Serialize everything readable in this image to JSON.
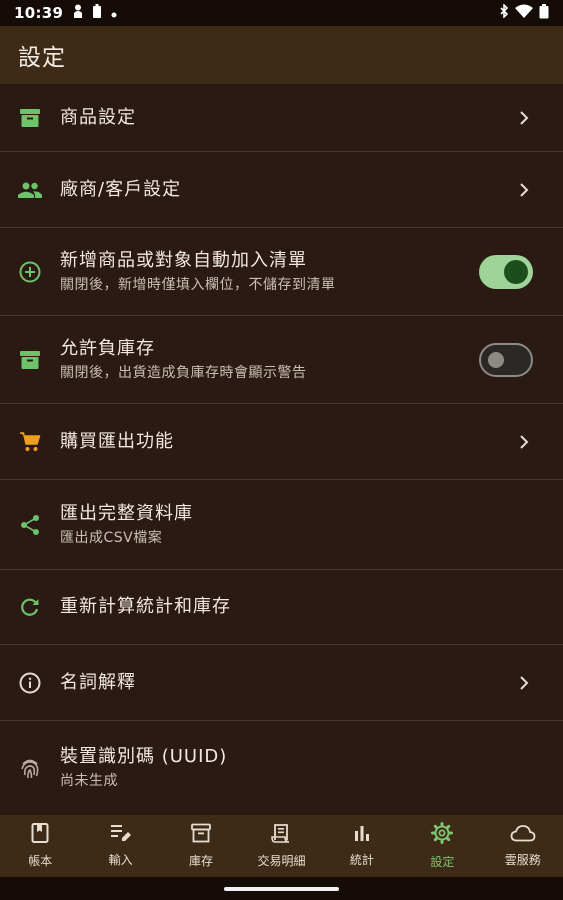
{
  "status_bar": {
    "time": "10:39",
    "left_icons": [
      "person-icon",
      "battery-saver-icon",
      "dot-icon"
    ],
    "right_icons": [
      "bluetooth-icon",
      "wifi-icon",
      "battery-icon"
    ]
  },
  "app_bar": {
    "title": "設定"
  },
  "settings": [
    {
      "id": "products",
      "title": "商品設定",
      "icon": "archive-icon",
      "icon_color": "#6cc36a",
      "control": "chevron"
    },
    {
      "id": "vendors",
      "title": "廠商/客戶設定",
      "icon": "people-icon",
      "icon_color": "#6cc36a",
      "control": "chevron"
    },
    {
      "id": "auto-add",
      "title": "新增商品或對象自動加入清單",
      "subtitle": "關閉後，新增時僅填入欄位，不儲存到清單",
      "icon": "add-circle-icon",
      "icon_color": "#6cc36a",
      "control": "toggle",
      "toggle_on": true
    },
    {
      "id": "negative-stock",
      "title": "允許負庫存",
      "subtitle": "關閉後，出貨造成負庫存時會顯示警告",
      "icon": "archive-icon",
      "icon_color": "#6cc36a",
      "control": "toggle",
      "toggle_on": false
    },
    {
      "id": "purchase-export",
      "title": "購買匯出功能",
      "icon": "cart-icon",
      "icon_color": "#f0a020",
      "control": "chevron"
    },
    {
      "id": "export-db",
      "title": "匯出完整資料庫",
      "subtitle": "匯出成CSV檔案",
      "icon": "share-icon",
      "icon_color": "#6cc36a",
      "control": "none"
    },
    {
      "id": "recalc",
      "title": "重新計算統計和庫存",
      "icon": "refresh-icon",
      "icon_color": "#6cc36a",
      "control": "none"
    },
    {
      "id": "glossary",
      "title": "名詞解釋",
      "icon": "info-icon",
      "icon_color": "#e6ddd2",
      "control": "chevron"
    },
    {
      "id": "uuid",
      "title": "裝置識別碼 (UUID)",
      "subtitle": "尚未生成",
      "icon": "fingerprint-icon",
      "icon_color": "#b8aca0",
      "control": "none"
    }
  ],
  "bottom_nav": [
    {
      "label": "帳本",
      "icon": "book-icon",
      "active": false
    },
    {
      "label": "輸入",
      "icon": "edit-list-icon",
      "active": false
    },
    {
      "label": "庫存",
      "icon": "archive-icon",
      "active": false
    },
    {
      "label": "交易明細",
      "icon": "receipt-icon",
      "active": false
    },
    {
      "label": "統計",
      "icon": "bar-chart-icon",
      "active": false
    },
    {
      "label": "設定",
      "icon": "gear-icon",
      "active": true
    },
    {
      "label": "雲服務",
      "icon": "cloud-icon",
      "active": false
    }
  ],
  "colors": {
    "background": "#2a1a13",
    "app_bar": "#3e2b17",
    "accent_green": "#6cc36a",
    "active_nav": "#7cc570"
  }
}
